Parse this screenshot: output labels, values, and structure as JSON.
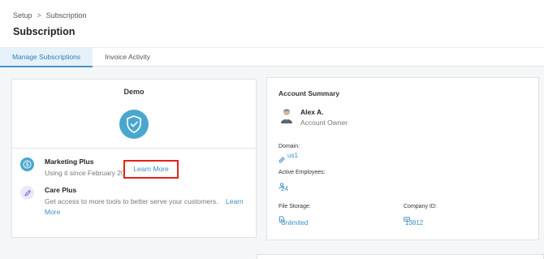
{
  "breadcrumb": {
    "parent": "Setup",
    "separator": ">",
    "current": "Subscription"
  },
  "page_title": "Subscription",
  "tabs": [
    {
      "label": "Manage Subscriptions",
      "active": true
    },
    {
      "label": "Invoice Activity",
      "active": false
    }
  ],
  "plan": {
    "name": "Demo",
    "icon": "shield-check-icon",
    "products": [
      {
        "name": "Marketing Plus",
        "description": "Using it since February 2024.",
        "link": "Learn More",
        "icon": "dollar-circle-icon",
        "icon_color": "#4ba6cf"
      },
      {
        "name": "Care Plus",
        "description": "Get access to more tools to better serve your customers.",
        "link": "Learn More",
        "icon": "pen-icon",
        "icon_color": "#7b6cd9"
      }
    ]
  },
  "account": {
    "title": "Account Summary",
    "owner_name": "Alex A.",
    "owner_role": "Account Owner",
    "domain_label": "Domain:",
    "domain_value": "us1",
    "employees_label": "Active Employees:",
    "employees_value": "24",
    "storage_label": "File Storage:",
    "storage_value": "Unlimited",
    "company_label": "Company ID:",
    "company_value": "13812"
  },
  "colors": {
    "accent": "#3a8fc4",
    "tab_active_bg": "#e6f1fa",
    "highlight_border": "#e2231a"
  }
}
